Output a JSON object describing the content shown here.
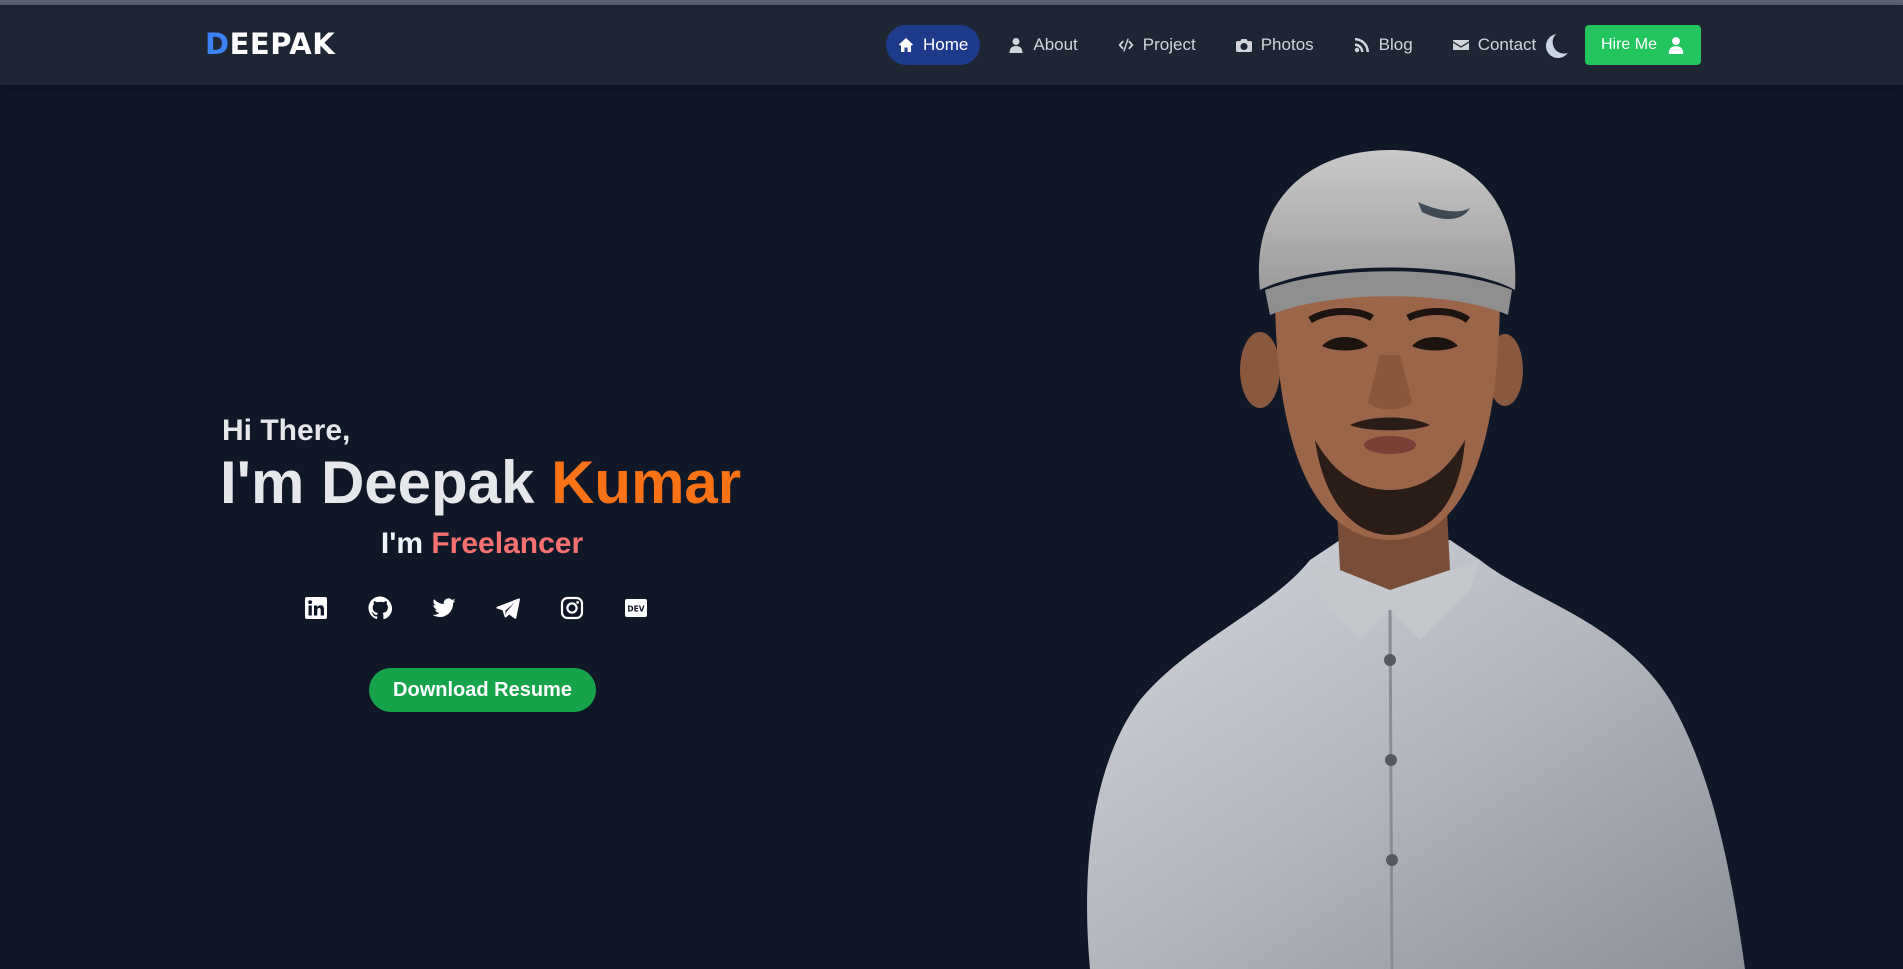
{
  "brand": {
    "first_letter": "D",
    "rest": "EEPAK",
    "accent": "#3b82f6"
  },
  "nav": {
    "items": [
      {
        "label": "Home",
        "icon": "home-icon",
        "active": true
      },
      {
        "label": "About",
        "icon": "user-icon"
      },
      {
        "label": "Project",
        "icon": "code-icon"
      },
      {
        "label": "Photos",
        "icon": "camera-icon"
      },
      {
        "label": "Blog",
        "icon": "rss-icon"
      },
      {
        "label": "Contact",
        "icon": "envelope-icon"
      }
    ],
    "theme_toggle_icon": "moon-icon",
    "hire_label": "Hire Me",
    "hire_icon": "user-icon"
  },
  "hero": {
    "greeting": "Hi There,",
    "name_first": "I'm Deepak ",
    "name_last": "Kumar",
    "role_prefix": "I'm ",
    "role_word": "Freelancer",
    "socials": [
      "linkedin-icon",
      "github-icon",
      "twitter-icon",
      "telegram-icon",
      "instagram-icon",
      "dev-icon"
    ],
    "resume_label": "Download Resume"
  },
  "colors": {
    "background": "#101726",
    "navbar": "#1e2634",
    "active_nav": "#1e3a8a",
    "hire_button": "#22c55e",
    "name_accent": "#f97316",
    "role_accent": "#f87171",
    "resume_button": "#16a34a"
  }
}
